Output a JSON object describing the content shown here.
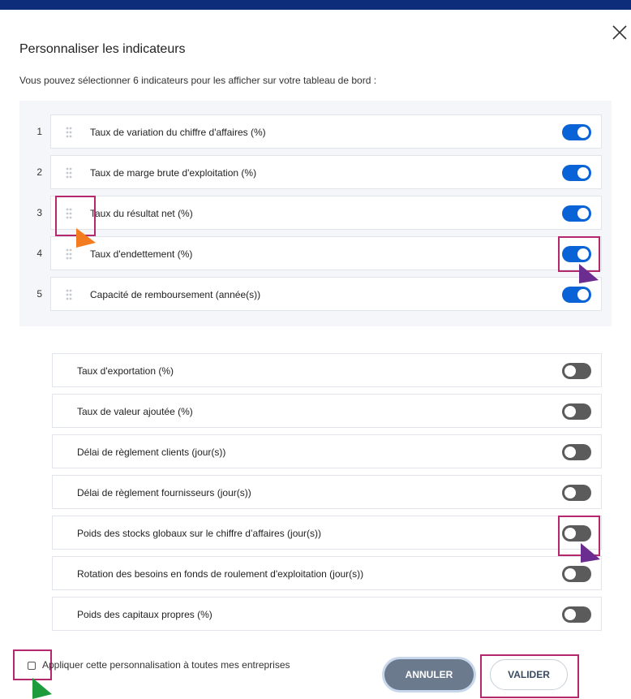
{
  "dialog": {
    "title": "Personnaliser les indicateurs",
    "subtitle": "Vous pouvez sélectionner 6 indicateurs pour les afficher sur votre tableau de bord :"
  },
  "selected_indicators": [
    {
      "number": "1",
      "label": "Taux de variation du chiffre d'affaires (%)",
      "enabled": true
    },
    {
      "number": "2",
      "label": "Taux de marge brute d'exploitation (%)",
      "enabled": true
    },
    {
      "number": "3",
      "label": "Taux du résultat net (%)",
      "enabled": true
    },
    {
      "number": "4",
      "label": "Taux d'endettement (%)",
      "enabled": true
    },
    {
      "number": "5",
      "label": "Capacité de remboursement (année(s))",
      "enabled": true
    }
  ],
  "available_indicators": [
    {
      "label": "Taux d'exportation (%)",
      "enabled": false
    },
    {
      "label": "Taux de valeur ajoutée (%)",
      "enabled": false
    },
    {
      "label": "Délai de règlement clients (jour(s))",
      "enabled": false
    },
    {
      "label": "Délai de règlement fournisseurs (jour(s))",
      "enabled": false
    },
    {
      "label": "Poids des stocks globaux sur le chiffre d’affaires (jour(s))",
      "enabled": false
    },
    {
      "label": "Rotation des besoins en fonds de roulement d'exploitation (jour(s))",
      "enabled": false
    },
    {
      "label": "Poids des capitaux propres (%)",
      "enabled": false
    }
  ],
  "footer": {
    "apply_all_label": "Appliquer cette personnalisation à toutes mes entreprises",
    "apply_all_checked": false,
    "cancel_label": "ANNULER",
    "validate_label": "VALIDER"
  },
  "colors": {
    "header_bar": "#0d2d7a",
    "toggle_on": "#0a63d6",
    "toggle_off": "#5b5b5b",
    "highlight": "#b5286e",
    "cursor_orange": "#f47c20",
    "cursor_purple": "#6b2d8f",
    "cursor_green": "#1e9b3c"
  },
  "icons": {
    "close": "close-icon",
    "drag": "drag-handle-icon"
  }
}
